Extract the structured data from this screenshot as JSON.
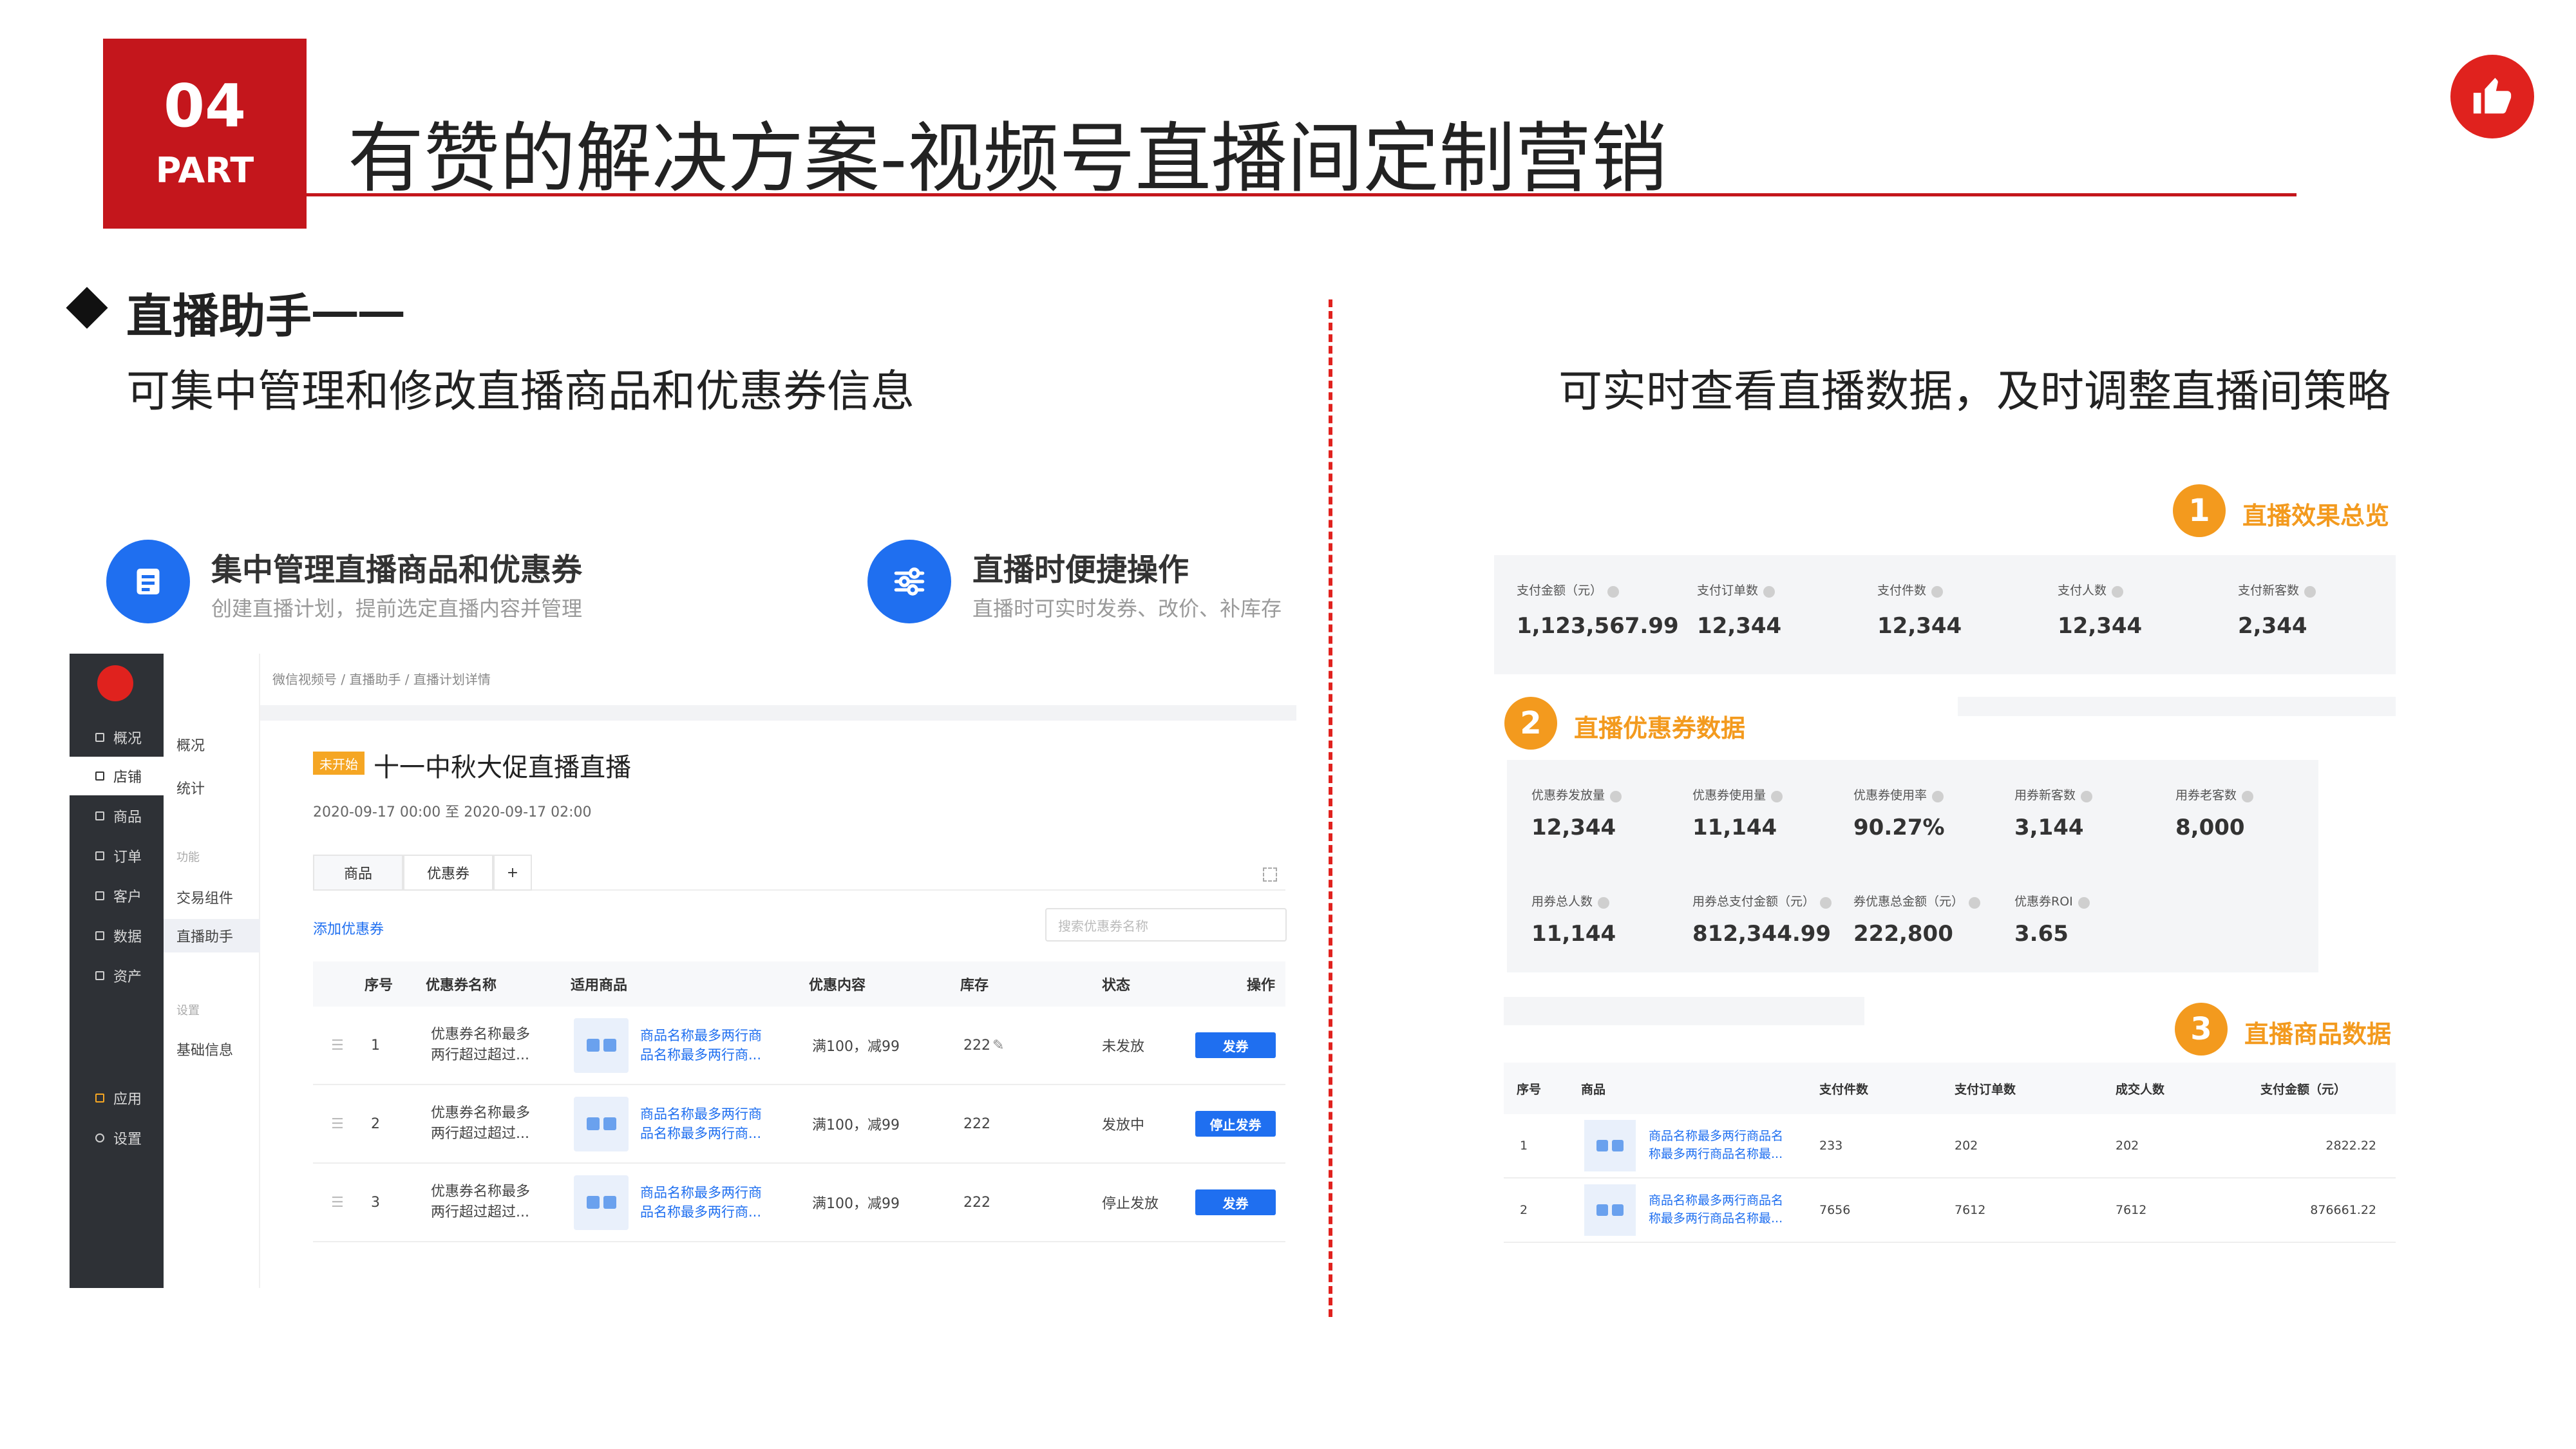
{
  "header": {
    "part_num": "04",
    "part_label": "PART",
    "title": "有赞的解决方案-视频号直播间定制营销"
  },
  "section": {
    "title": "直播助手一一",
    "left_subtitle": "可集中管理和修改直播商品和优惠券信息",
    "right_subtitle": "可实时查看直播数据，及时调整直播间策略"
  },
  "features": [
    {
      "title": "集中管理直播商品和优惠券",
      "sub": "创建直播计划，提前选定直播内容并管理",
      "icon": "document-icon"
    },
    {
      "title": "直播时便捷操作",
      "sub": "直播时可实时发券、改价、补库存",
      "icon": "sliders-icon"
    }
  ],
  "app": {
    "sidebar": [
      {
        "label": "概况",
        "icon": "overview-icon"
      },
      {
        "label": "店铺",
        "icon": "store-icon",
        "active": true
      },
      {
        "label": "商品",
        "icon": "goods-icon"
      },
      {
        "label": "订单",
        "icon": "order-icon"
      },
      {
        "label": "客户",
        "icon": "customer-icon"
      },
      {
        "label": "数据",
        "icon": "data-icon"
      },
      {
        "label": "资产",
        "icon": "asset-icon"
      },
      {
        "label": "应用",
        "icon": "apps-icon"
      },
      {
        "label": "设置",
        "icon": "settings-icon"
      }
    ],
    "subnav": {
      "overview": "概况",
      "stats": "统计",
      "func_header": "功能",
      "trade": "交易组件",
      "live": "直播助手",
      "settings_header": "设置",
      "basic": "基础信息"
    },
    "breadcrumb": "微信视频号 / 直播助手 / 直播计划详情",
    "badge": "未开始",
    "live_title": "十一中秋大促直播直播",
    "live_time": "2020-09-17 00:00 至 2020-09-17 02:00",
    "tabs": [
      "商品",
      "优惠券",
      "+"
    ],
    "add_coupon": "添加优惠券",
    "search_placeholder": "搜索优惠券名称",
    "table_headers": [
      "序号",
      "优惠券名称",
      "适用商品",
      "优惠内容",
      "库存",
      "状态",
      "操作"
    ],
    "rows": [
      {
        "no": "1",
        "name_l1": "优惠券名称最多",
        "name_l2": "两行超过超过...",
        "goods_l1": "商品名称最多两行商",
        "goods_l2": "品名称最多两行商...",
        "content": "满100，减99",
        "stock": "222",
        "status": "未发放",
        "action": "发券"
      },
      {
        "no": "2",
        "name_l1": "优惠券名称最多",
        "name_l2": "两行超过超过...",
        "goods_l1": "商品名称最多两行商",
        "goods_l2": "品名称最多两行商...",
        "content": "满100，减99",
        "stock": "222",
        "status": "发放中",
        "action": "停止发券"
      },
      {
        "no": "3",
        "name_l1": "优惠券名称最多",
        "name_l2": "两行超过超过...",
        "goods_l1": "商品名称最多两行商",
        "goods_l2": "品名称最多两行商...",
        "content": "满100，减99",
        "stock": "222",
        "status": "停止发放",
        "action": "发券"
      }
    ]
  },
  "overview": {
    "num": "1",
    "label": "直播效果总览",
    "metrics": [
      {
        "label": "支付金额（元）",
        "value": "1,123,567.99"
      },
      {
        "label": "支付订单数",
        "value": "12,344"
      },
      {
        "label": "支付件数",
        "value": "12,344"
      },
      {
        "label": "支付人数",
        "value": "12,344"
      },
      {
        "label": "支付新客数",
        "value": "2,344"
      }
    ]
  },
  "coupon_data": {
    "num": "2",
    "label": "直播优惠券数据",
    "row1": [
      {
        "label": "优惠券发放量",
        "value": "12,344"
      },
      {
        "label": "优惠券使用量",
        "value": "11,144"
      },
      {
        "label": "优惠券使用率",
        "value": "90.27%"
      },
      {
        "label": "用券新客数",
        "value": "3,144"
      },
      {
        "label": "用券老客数",
        "value": "8,000"
      }
    ],
    "row2": [
      {
        "label": "用券总人数",
        "value": "11,144"
      },
      {
        "label": "用券总支付金额（元）",
        "value": "812,344.99"
      },
      {
        "label": "券优惠总金额（元）",
        "value": "222,800"
      },
      {
        "label": "优惠券ROI",
        "value": "3.65"
      }
    ]
  },
  "goods_data": {
    "num": "3",
    "label": "直播商品数据",
    "headers": [
      "序号",
      "商品",
      "支付件数",
      "支付订单数",
      "成交人数",
      "支付金额（元）"
    ],
    "rows": [
      {
        "no": "1",
        "name_l1": "商品名称最多两行商品名",
        "name_l2": "称最多两行商品名称最...",
        "qty": "233",
        "orders": "202",
        "buyers": "202",
        "amount": "2822.22"
      },
      {
        "no": "2",
        "name_l1": "商品名称最多两行商品名",
        "name_l2": "称最多两行商品名称最...",
        "qty": "7656",
        "orders": "7612",
        "buyers": "7612",
        "amount": "876661.22"
      }
    ]
  },
  "colors": {
    "brand_red": "#c4161c",
    "accent_blue": "#1f6ff0",
    "accent_orange": "#f39a1e"
  }
}
